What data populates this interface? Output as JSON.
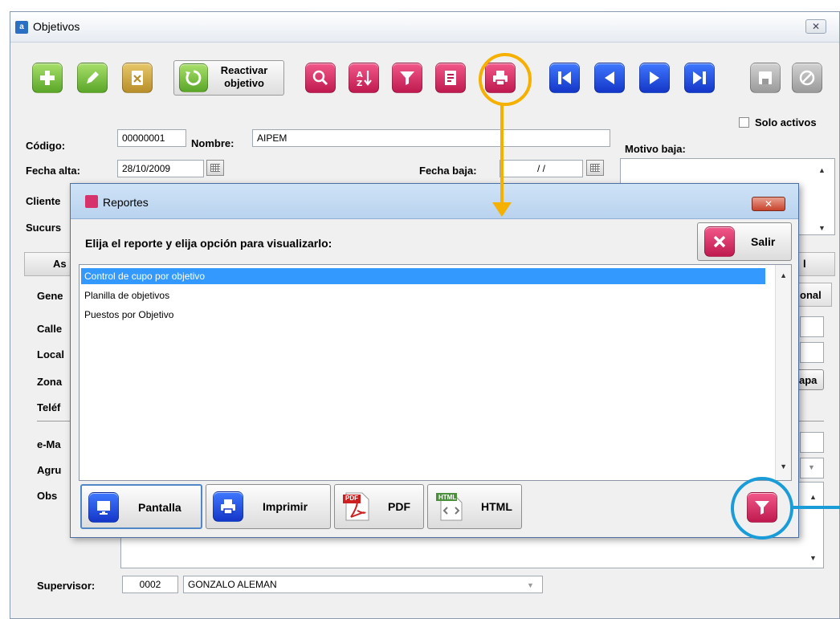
{
  "main_window": {
    "title": "Objetivos",
    "close_glyph": "✕"
  },
  "toolbar": {
    "reactivar_label": "Reactivar objetivo",
    "icons": [
      "add-icon",
      "edit-icon",
      "delete-icon",
      "reactivate-icon",
      "search-icon",
      "sort-az-icon",
      "filter-icon",
      "notes-icon",
      "print-icon",
      "first-record-icon",
      "previous-record-icon",
      "next-record-icon",
      "last-record-icon",
      "save-icon",
      "cancel-icon"
    ]
  },
  "form": {
    "solo_activos_label": "Solo activos",
    "codigo_label": "Código:",
    "codigo_value": "00000001",
    "nombre_label": "Nombre:",
    "nombre_value": "AIPEM",
    "motivo_baja_label": "Motivo baja:",
    "fecha_alta_label": "Fecha alta:",
    "fecha_alta_value": "28/10/2009",
    "fecha_baja_label": "Fecha baja:",
    "fecha_baja_value": "/ /",
    "cliente_label": "Cliente",
    "sucursal_label": "Sucurs",
    "tab_left_label": "As",
    "tab_right_label": "l",
    "gene_label": "Gene",
    "onal_label": "onal",
    "calle_label": "Calle",
    "local_label": "Local",
    "zona_label": "Zona",
    "mapa_label": "apa",
    "telef_label": "Teléf",
    "email_label": "e-Ma",
    "agru_label": "Agru",
    "obs_label": "Obs",
    "supervisor_label": "Supervisor:",
    "supervisor_code": "0002",
    "supervisor_name": "GONZALO ALEMAN"
  },
  "dialog": {
    "title": "Reportes",
    "close_glyph": "✕",
    "instruction": "Elija el reporte y elija opción para visualizarlo:",
    "salir_label": "Salir",
    "reports": [
      "Control de cupo por objetivo",
      "Planilla de objetivos",
      "Puestos por Objetivo"
    ],
    "selected_index": 0,
    "buttons": {
      "pantalla": "Pantalla",
      "imprimir": "Imprimir",
      "pdf": "PDF",
      "html": "HTML"
    },
    "pdf_badge": "PDF",
    "html_badge": "HTML"
  },
  "colors": {
    "annotation_orange": "#f5b000",
    "annotation_blue": "#1a9cd8",
    "selection_blue": "#3399ff"
  }
}
